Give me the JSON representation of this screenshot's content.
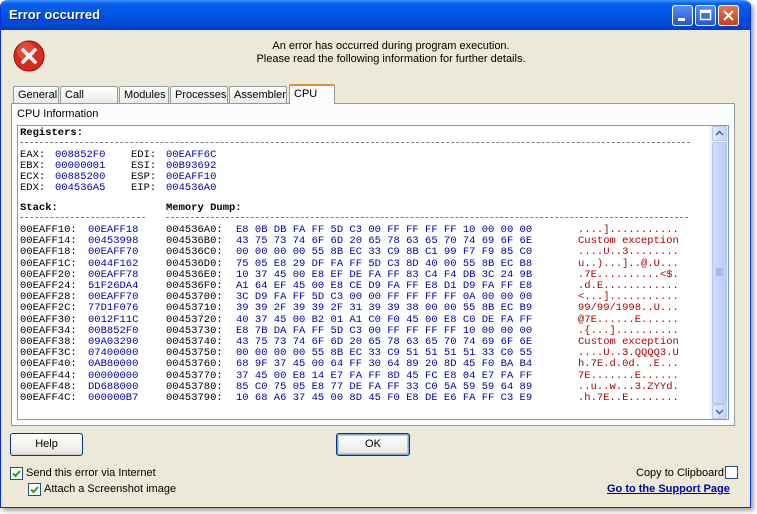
{
  "window": {
    "title": "Error occurred"
  },
  "message": {
    "line1": "An error has occurred during program execution.",
    "line2": "Please read the following information for further details."
  },
  "tabs": [
    "General",
    "Call Stack",
    "Modules",
    "Processes",
    "Assembler",
    "CPU"
  ],
  "active_tab": "CPU",
  "panel": {
    "label": "CPU Information"
  },
  "registers": {
    "header": "Registers:",
    "rows": [
      {
        "l": "EAX:",
        "lv": "008852F0",
        "r": "EDI:",
        "rv": "00EAFF6C"
      },
      {
        "l": "EBX:",
        "lv": "00000001",
        "r": "ESI:",
        "rv": "00B93692"
      },
      {
        "l": "ECX:",
        "lv": "00885200",
        "r": "ESP:",
        "rv": "00EAFF10"
      },
      {
        "l": "EDX:",
        "lv": "004536A5",
        "r": "EIP:",
        "rv": "004536A0"
      }
    ]
  },
  "stack": {
    "header": "Stack:",
    "rows": [
      [
        "00EAFF10:",
        "00EAFF18"
      ],
      [
        "00EAFF14:",
        "00453998"
      ],
      [
        "00EAFF18:",
        "00EAFF70"
      ],
      [
        "00EAFF1C:",
        "0044F162"
      ],
      [
        "00EAFF20:",
        "00EAFF78"
      ],
      [
        "00EAFF24:",
        "51F26DA4"
      ],
      [
        "00EAFF28:",
        "00EAFF70"
      ],
      [
        "00EAFF2C:",
        "77D1F076"
      ],
      [
        "00EAFF30:",
        "0012F11C"
      ],
      [
        "00EAFF34:",
        "00B852F0"
      ],
      [
        "00EAFF38:",
        "09A03290"
      ],
      [
        "00EAFF3C:",
        "07400000"
      ],
      [
        "00EAFF40:",
        "0AB80000"
      ],
      [
        "00EAFF44:",
        "00000000"
      ],
      [
        "00EAFF48:",
        "DD688000"
      ],
      [
        "00EAFF4C:",
        "000000B7"
      ]
    ]
  },
  "memory": {
    "header": "Memory Dump:",
    "rows": [
      [
        "004536A0:",
        "E8 0B DB FA FF 5D C3 00 FF FF FF FF 10 00 00 00",
        "....]..........."
      ],
      [
        "004536B0:",
        "43 75 73 74 6F 6D 20 65 78 63 65 70 74 69 6F 6E",
        "Custom exception"
      ],
      [
        "004536C0:",
        "00 00 00 00 55 8B EC 33 C9 8B C1 99 F7 F9 85 C0",
        "....U..3........"
      ],
      [
        "004536D0:",
        "75 05 E8 29 DF FA FF 5D C3 8D 40 00 55 8B EC B8",
        "u..)...]..@.U..."
      ],
      [
        "004536E0:",
        "10 37 45 00 E8 EF DE FA FF 83 C4 F4 DB 3C 24 9B",
        ".7E..........<$."
      ],
      [
        "004536F0:",
        "A1 64 EF 45 00 E8 CE D9 FA FF E8 D1 D9 FA FF E8",
        ".d.E............"
      ],
      [
        "00453700:",
        "3C D9 FA FF 5D C3 00 00 FF FF FF FF 0A 00 00 00",
        "<...]..........."
      ],
      [
        "00453710:",
        "39 39 2F 39 39 2F 31 39 39 38 00 00 55 8B EC B9",
        "99/99/1998..U..."
      ],
      [
        "00453720:",
        "40 37 45 00 B2 01 A1 C0 F0 45 00 E8 C0 DE FA FF",
        "@7E......E......"
      ],
      [
        "00453730:",
        "E8 7B DA FA FF 5D C3 00 FF FF FF FF 10 00 00 00",
        ".{...].........."
      ],
      [
        "00453740:",
        "43 75 73 74 6F 6D 20 65 78 63 65 70 74 69 6F 6E",
        "Custom exception"
      ],
      [
        "00453750:",
        "00 00 00 00 55 8B EC 33 C9 51 51 51 51 33 C0 55",
        "....U..3.QQQQ3.U"
      ],
      [
        "00453760:",
        "68 9F 37 45 00 64 FF 30 64 89 20 8D 45 F0 BA B4",
        "h.7E.d.0d. .E..."
      ],
      [
        "00453770:",
        "37 45 00 E8 14 E7 FA FF 8D 45 FC E8 04 E7 FA FF",
        "7E.......E......"
      ],
      [
        "00453780:",
        "85 C0 75 05 E8 77 DE FA FF 33 C0 5A 59 59 64 89",
        "..u..w...3.ZYYd."
      ],
      [
        "00453790:",
        "10 68 A6 37 45 00 8D 45 F0 E8 DE E6 FA FF C3 E9",
        ".h.7E..E........"
      ]
    ]
  },
  "buttons": {
    "help": "Help",
    "ok": "OK"
  },
  "options": {
    "send_internet": "Send this error via Internet",
    "attach_screenshot": "Attach a Screenshot image",
    "copy_clipboard": "Copy to Clipboard",
    "support_link": "Go to the Support Page"
  },
  "colors": {
    "title_bar": "#0055E5",
    "hex_values": "#0000B0",
    "ascii_values": "#B00000",
    "dialog_bg": "#ECE9D8"
  }
}
